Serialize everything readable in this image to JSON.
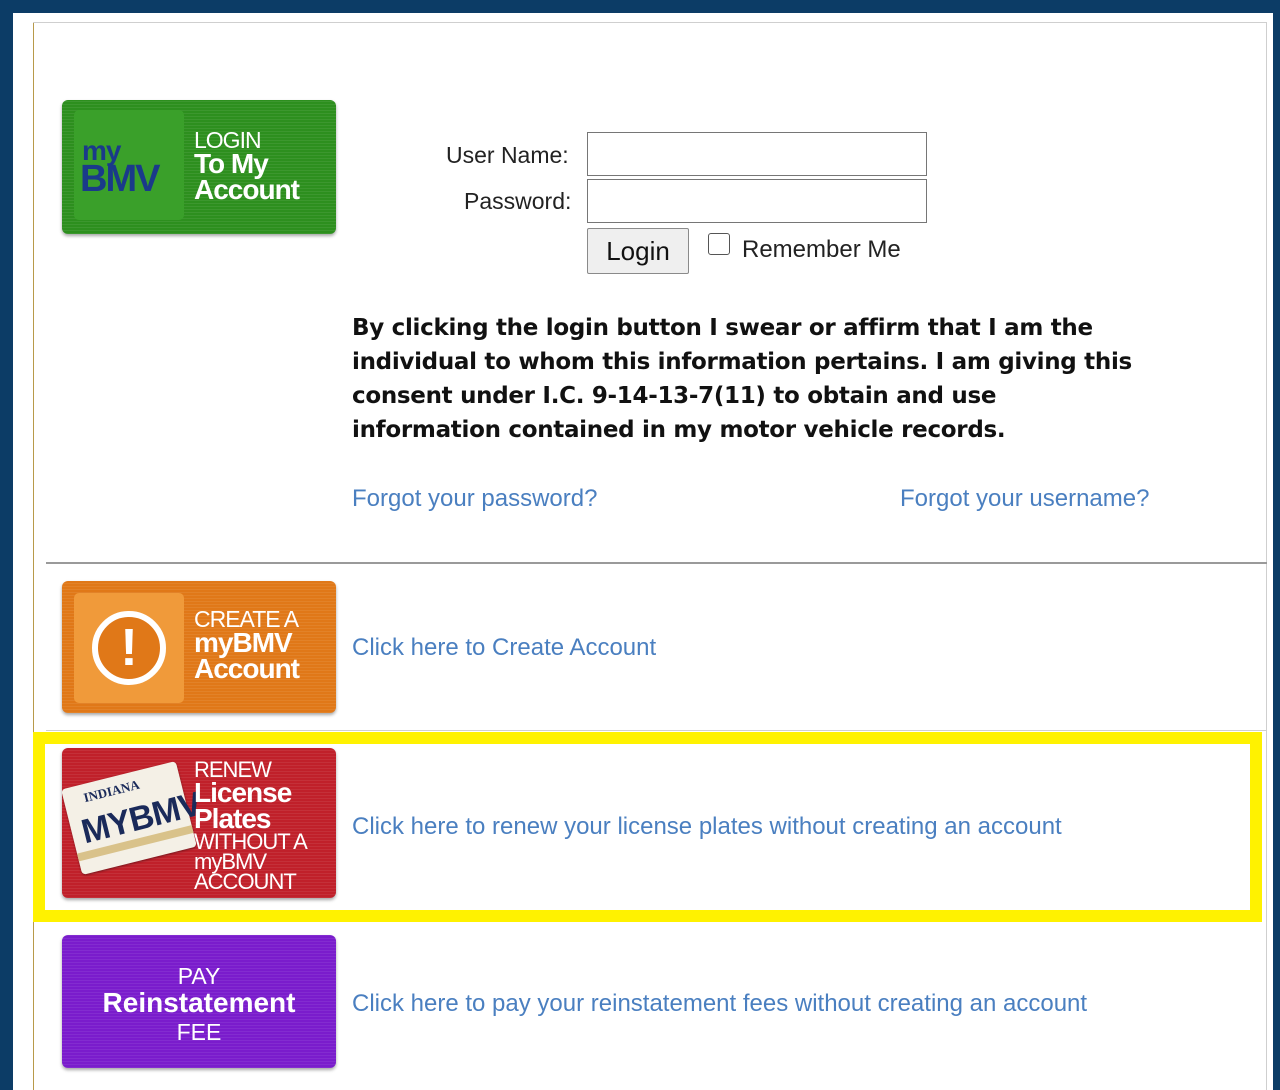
{
  "login_tile": {
    "my": "my",
    "bmv": "BMV",
    "line1": "LOGIN",
    "line2": "To My",
    "line3": "Account"
  },
  "form": {
    "username_label": "User Name:",
    "password_label": "Password:",
    "username_value": "",
    "password_value": "",
    "login_button": "Login",
    "remember_me": "Remember Me",
    "remember_checked": false
  },
  "consent_text": "By clicking the login button I swear or affirm that I am the individual to whom this information pertains. I am giving this consent under I.C. 9-14-13-7(11) to obtain and use information contained in my motor vehicle records.",
  "links": {
    "forgot_password": "Forgot your password?",
    "forgot_username": "Forgot your username?"
  },
  "create_tile": {
    "icon": "!",
    "line1": "CREATE A",
    "line2": "myBMV",
    "line3": "Account",
    "link": "Click here to Create Account"
  },
  "renew_tile": {
    "plate_state": "INDIANA",
    "plate_number": "MYBMV",
    "line1": "RENEW",
    "line2": "License",
    "line3": "Plates",
    "line4": "WITHOUT A",
    "line5": "myBMV",
    "line6": "ACCOUNT",
    "link": "Click here to renew your license plates without creating an account"
  },
  "pay_tile": {
    "line1": "PAY",
    "line2": "Reinstatement",
    "line3": "FEE",
    "link": "Click here to pay your reinstatement fees without creating an account"
  },
  "colors": {
    "frame": "#0c3c66",
    "link": "#4a7fc0",
    "highlight": "#fff200",
    "login_tile": "#2d8f1e",
    "create_tile": "#e07818",
    "renew_tile": "#c0202a",
    "pay_tile": "#7a1ccc"
  }
}
